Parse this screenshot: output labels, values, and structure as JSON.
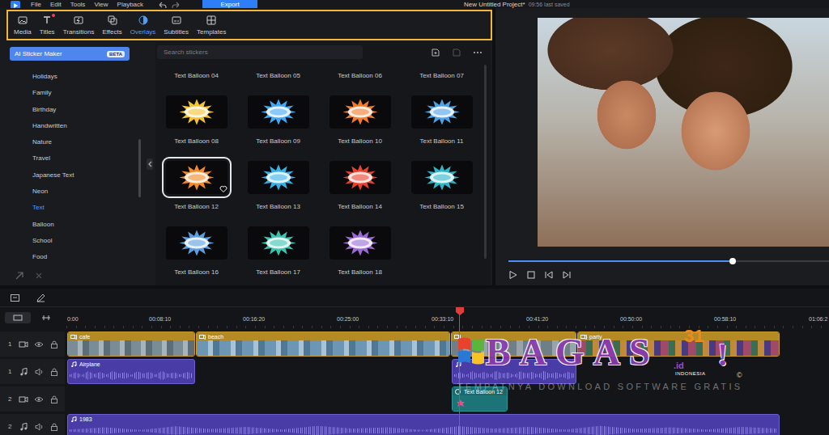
{
  "menu_bar": {
    "items": [
      "File",
      "Edit",
      "Tools",
      "View",
      "Playback"
    ],
    "export_button": "Export",
    "project_title": "New Untitled Project*",
    "save_status": "09:56 last saved"
  },
  "toolbar": {
    "highlighted": true,
    "tabs": [
      {
        "label": "Media",
        "selected": false,
        "badge": false
      },
      {
        "label": "Titles",
        "selected": false,
        "badge": true
      },
      {
        "label": "Transitions",
        "selected": false,
        "badge": false
      },
      {
        "label": "Effects",
        "selected": false,
        "badge": false
      },
      {
        "label": "Overlays",
        "selected": true,
        "badge": false
      },
      {
        "label": "Subtitles",
        "selected": false,
        "badge": false
      },
      {
        "label": "Templates",
        "selected": false,
        "badge": false
      }
    ]
  },
  "sidebar": {
    "ai_button": {
      "label": "AI Sticker Maker",
      "badge": "BETA"
    },
    "items": [
      {
        "label": "Holidays",
        "selected": false
      },
      {
        "label": "Family",
        "selected": false
      },
      {
        "label": "Birthday",
        "selected": false
      },
      {
        "label": "Handwritten",
        "selected": false
      },
      {
        "label": "Nature",
        "selected": false
      },
      {
        "label": "Travel",
        "selected": false
      },
      {
        "label": "Japanese Text",
        "selected": false
      },
      {
        "label": "Neon",
        "selected": false
      },
      {
        "label": "Text",
        "selected": true
      },
      {
        "label": "Balloon",
        "selected": false
      },
      {
        "label": "School",
        "selected": false
      },
      {
        "label": "Food",
        "selected": false
      }
    ]
  },
  "stickers": {
    "search": {
      "placeholder": "Search stickers"
    },
    "header_labels": [
      "Text Balloon 04",
      "Text Balloon 05",
      "Text Balloon 06",
      "Text Balloon 07"
    ],
    "items": [
      {
        "label": "Text Balloon 08",
        "selected": false,
        "color": "#f4c430"
      },
      {
        "label": "Text Balloon 09",
        "selected": false,
        "color": "#3fa9f5"
      },
      {
        "label": "Text Balloon 10",
        "selected": false,
        "color": "#f27a2a"
      },
      {
        "label": "Text Balloon 11",
        "selected": false,
        "color": "#4aa3e6"
      },
      {
        "label": "Text Balloon 12",
        "selected": true,
        "color": "#f28a2a"
      },
      {
        "label": "Text Balloon 13",
        "selected": false,
        "color": "#3ab0e8"
      },
      {
        "label": "Text Balloon 14",
        "selected": false,
        "color": "#e8432f"
      },
      {
        "label": "Text Balloon 15",
        "selected": false,
        "color": "#2fb7c9"
      },
      {
        "label": "Text Balloon 16",
        "selected": false,
        "color": "#5aa0e0"
      },
      {
        "label": "Text Balloon 17",
        "selected": false,
        "color": "#39c4b0"
      },
      {
        "label": "Text Balloon 18",
        "selected": false,
        "color": "#9b6ad8"
      }
    ]
  },
  "preview": {
    "level": 0.7
  },
  "timeline": {
    "ruler": [
      "0:00",
      "00:08:10",
      "00:16:20",
      "00:25:00",
      "00:33:10",
      "00:41:20",
      "00:50:00",
      "00:58:10",
      "01:06:2"
    ],
    "playhead_level": 0.515,
    "tracks": [
      {
        "number": "1",
        "kind": "video",
        "clips": [
          {
            "label": "cafe",
            "kind": "video"
          },
          {
            "label": "beach",
            "kind": "video"
          },
          {
            "kind": "video"
          },
          {
            "label": "party",
            "kind": "video"
          }
        ]
      },
      {
        "number": "1",
        "kind": "audio",
        "clips": [
          {
            "label": "Airplane",
            "kind": "audio"
          },
          {
            "kind": "audio"
          }
        ]
      },
      {
        "number": "2",
        "kind": "video",
        "clips": [
          {
            "label": "Text Balloon 12",
            "kind": "sticker"
          }
        ]
      },
      {
        "number": "2",
        "kind": "audio",
        "clips": [
          {
            "label": "1983",
            "kind": "audio"
          }
        ]
      }
    ]
  },
  "watermark": {
    "brand": "BAGAS",
    "number": "31",
    "domain": ".id",
    "country": "INDONESIA",
    "exclaim": "!",
    "copyright": "©",
    "tagline": "TEMPATNYA DOWNLOAD SOFTWARE GRATIS"
  }
}
